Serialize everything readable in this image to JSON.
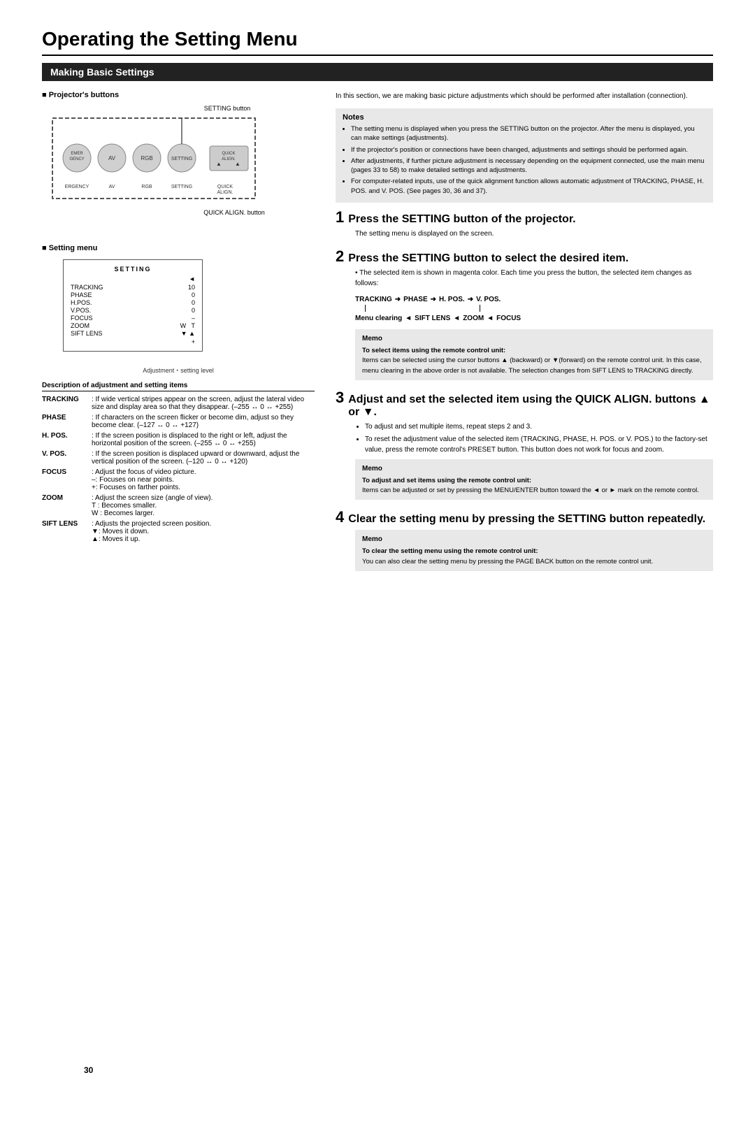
{
  "page": {
    "title": "Operating the Setting Menu",
    "section": "Making Basic Settings",
    "page_number": "30"
  },
  "left": {
    "projectors_buttons_heading": "Projector's buttons",
    "setting_button_label": "SETTING button",
    "quick_align_label": "QUICK ALIGN. button",
    "button_labels": [
      "ERGENCY",
      "AV",
      "RGB",
      "SETTING",
      "QUICK ALIGN."
    ],
    "setting_menu_heading": "Setting menu",
    "setting_menu_title": "SETTING",
    "setting_menu_items": [
      {
        "name": "TRACKING",
        "value": "10"
      },
      {
        "name": "PHASE",
        "value": "0"
      },
      {
        "name": "H.POS.",
        "value": "0"
      },
      {
        "name": "V.POS.",
        "value": "0"
      },
      {
        "name": "FOCUS",
        "value": "–"
      },
      {
        "name": "ZOOM",
        "value": "W  T"
      },
      {
        "name": "SIFT LENS",
        "value": "▼ ▲"
      }
    ],
    "adjustment_label": "Adjustment・setting level",
    "description_heading": "Description of adjustment and setting items",
    "descriptions": [
      {
        "term": "TRACKING",
        "def": ": If wide vertical stripes appear on the screen, adjust the lateral video size and display area so that they disappear. (–255 ↔ 0 ↔ +255)"
      },
      {
        "term": "PHASE",
        "def": ": If characters on the screen flicker or become dim, adjust so they become clear. (–127 ↔ 0 ↔ +127)"
      },
      {
        "term": "H. POS.",
        "def": ": If the screen position is displaced to the right or left, adjust the horizontal position of the screen. (–255 ↔ 0 ↔ +255)"
      },
      {
        "term": "V. POS.",
        "def": ": If the screen position is displaced upward or downward, adjust the vertical position of the screen. (–120 ↔ 0 ↔ +120)"
      },
      {
        "term": "FOCUS",
        "def": ": Adjust the focus of video picture. –: Focuses on near points. +: Focuses on farther points."
      },
      {
        "term": "ZOOM",
        "def": ": Adjust the screen size (angle of view). T : Becomes smaller. W : Becomes larger."
      },
      {
        "term": "SIFT LENS",
        "def": ": Adjusts the projected screen position. ▼: Moves it down. ▲: Moves it up."
      }
    ]
  },
  "right": {
    "intro": "In this section, we are making basic picture adjustments which should be performed after installation (connection).",
    "notes_title": "Notes",
    "notes": [
      "The setting menu is displayed when you press the SETTING button on the projector. After the menu is displayed, you can make settings (adjustments).",
      "If the projector's position or connections have been changed, adjustments and settings should be performed again.",
      "After adjustments, if further picture adjustment is necessary depending on the equipment connected, use the main menu (pages 33 to 58) to make detailed settings and adjustments.",
      "For computer-related inputs, use of the quick alignment function allows automatic adjustment of TRACKING, PHASE, H. POS. and V. POS. (See pages 30, 36 and 37)."
    ],
    "steps": [
      {
        "number": "1",
        "title": "Press the SETTING button of the projector.",
        "body": "The setting menu is displayed on the screen."
      },
      {
        "number": "2",
        "title": "Press the SETTING button to select the desired item.",
        "body": "The selected item is shown in magenta color. Each time you press the button, the selected item changes as follows:",
        "flow_line1": [
          "TRACKING",
          "→",
          "PHASE",
          "→",
          "H. POS.",
          "→",
          "V. POS."
        ],
        "flow_line2_left": "Menu clearing",
        "flow_line2_arrow_left": "←",
        "flow_line2_middle": "SIFT LENS",
        "flow_line2_arrow_mid": "←",
        "flow_line2_item": "ZOOM",
        "flow_line2_arrow": "←",
        "flow_line2_end": "FOCUS",
        "memo_title": "Memo",
        "memo_subheading": "To select items using the remote control unit:",
        "memo_body": "Items can be selected using the cursor buttons ▲ (backward) or ▼(forward) on the remote control unit. In this case, menu clearing in the above order is not available. The selection changes from SIFT LENS to TRACKING directly."
      },
      {
        "number": "3",
        "title": "Adjust and set the selected item using the QUICK ALIGN. buttons ▲ or ▼.",
        "body_bullets": [
          "To adjust and set multiple items, repeat steps 2 and 3.",
          "To reset the adjustment value of the selected item (TRACKING, PHASE, H. POS. or V. POS.) to the factory-set value, press the remote control's PRESET button. This button does not work for focus and zoom."
        ],
        "memo_title": "Memo",
        "memo_subheading": "To adjust and set items using the remote control unit:",
        "memo_body": "Items can be adjusted or set by pressing the MENU/ENTER button toward the ◄ or ► mark on the remote control."
      },
      {
        "number": "4",
        "title": "Clear the setting menu by pressing the SETTING button repeatedly.",
        "memo_title": "Memo",
        "memo_subheading": "To clear the setting menu using the remote control unit:",
        "memo_body": "You can also clear the setting menu by pressing the PAGE BACK button on the remote control unit."
      }
    ]
  }
}
